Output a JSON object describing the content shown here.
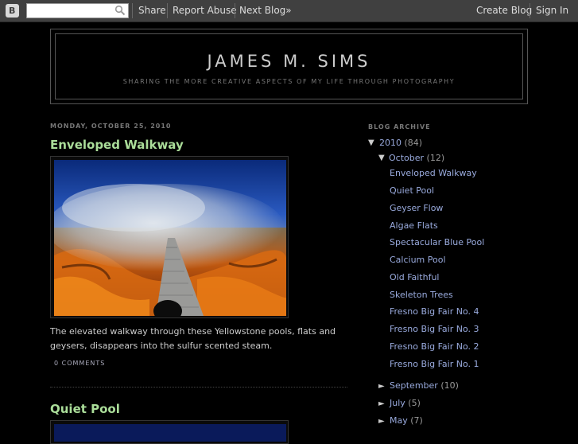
{
  "navbar": {
    "search_placeholder": "",
    "links": {
      "share": "Share",
      "report": "Report Abuse",
      "next": "Next Blog»",
      "create": "Create Blog",
      "signin": "Sign In"
    }
  },
  "header": {
    "title": "JAMES M. SIMS",
    "description": "SHARING THE MORE CREATIVE ASPECTS OF MY LIFE THROUGH PHOTOGRAPHY"
  },
  "main": {
    "date": "MONDAY, OCTOBER 25, 2010",
    "posts": [
      {
        "title": "Enveloped Walkway",
        "body": "The elevated walkway through these Yellowstone pools, flats and geysers, disappears into the sulfur scented steam.",
        "comments": "0 COMMENTS"
      },
      {
        "title": "Quiet Pool"
      }
    ]
  },
  "sidebar": {
    "title": "BLOG ARCHIVE",
    "year": {
      "toggle": "▼",
      "label": "2010",
      "count": "(84)"
    },
    "month": {
      "toggle": "▼",
      "label": "October",
      "count": "(12)"
    },
    "posts": [
      "Enveloped Walkway",
      "Quiet Pool",
      "Geyser Flow",
      "Algae Flats",
      "Spectacular Blue Pool",
      "Calcium Pool",
      "Old Faithful",
      "Skeleton Trees",
      "Fresno Big Fair No. 4",
      "Fresno Big Fair No. 3",
      "Fresno Big Fair No. 2",
      "Fresno Big Fair No. 1"
    ],
    "other_months": [
      {
        "toggle": "►",
        "label": "September",
        "count": "(10)"
      },
      {
        "toggle": "►",
        "label": "July",
        "count": "(5)"
      },
      {
        "toggle": "►",
        "label": "May",
        "count": "(7)"
      }
    ]
  }
}
